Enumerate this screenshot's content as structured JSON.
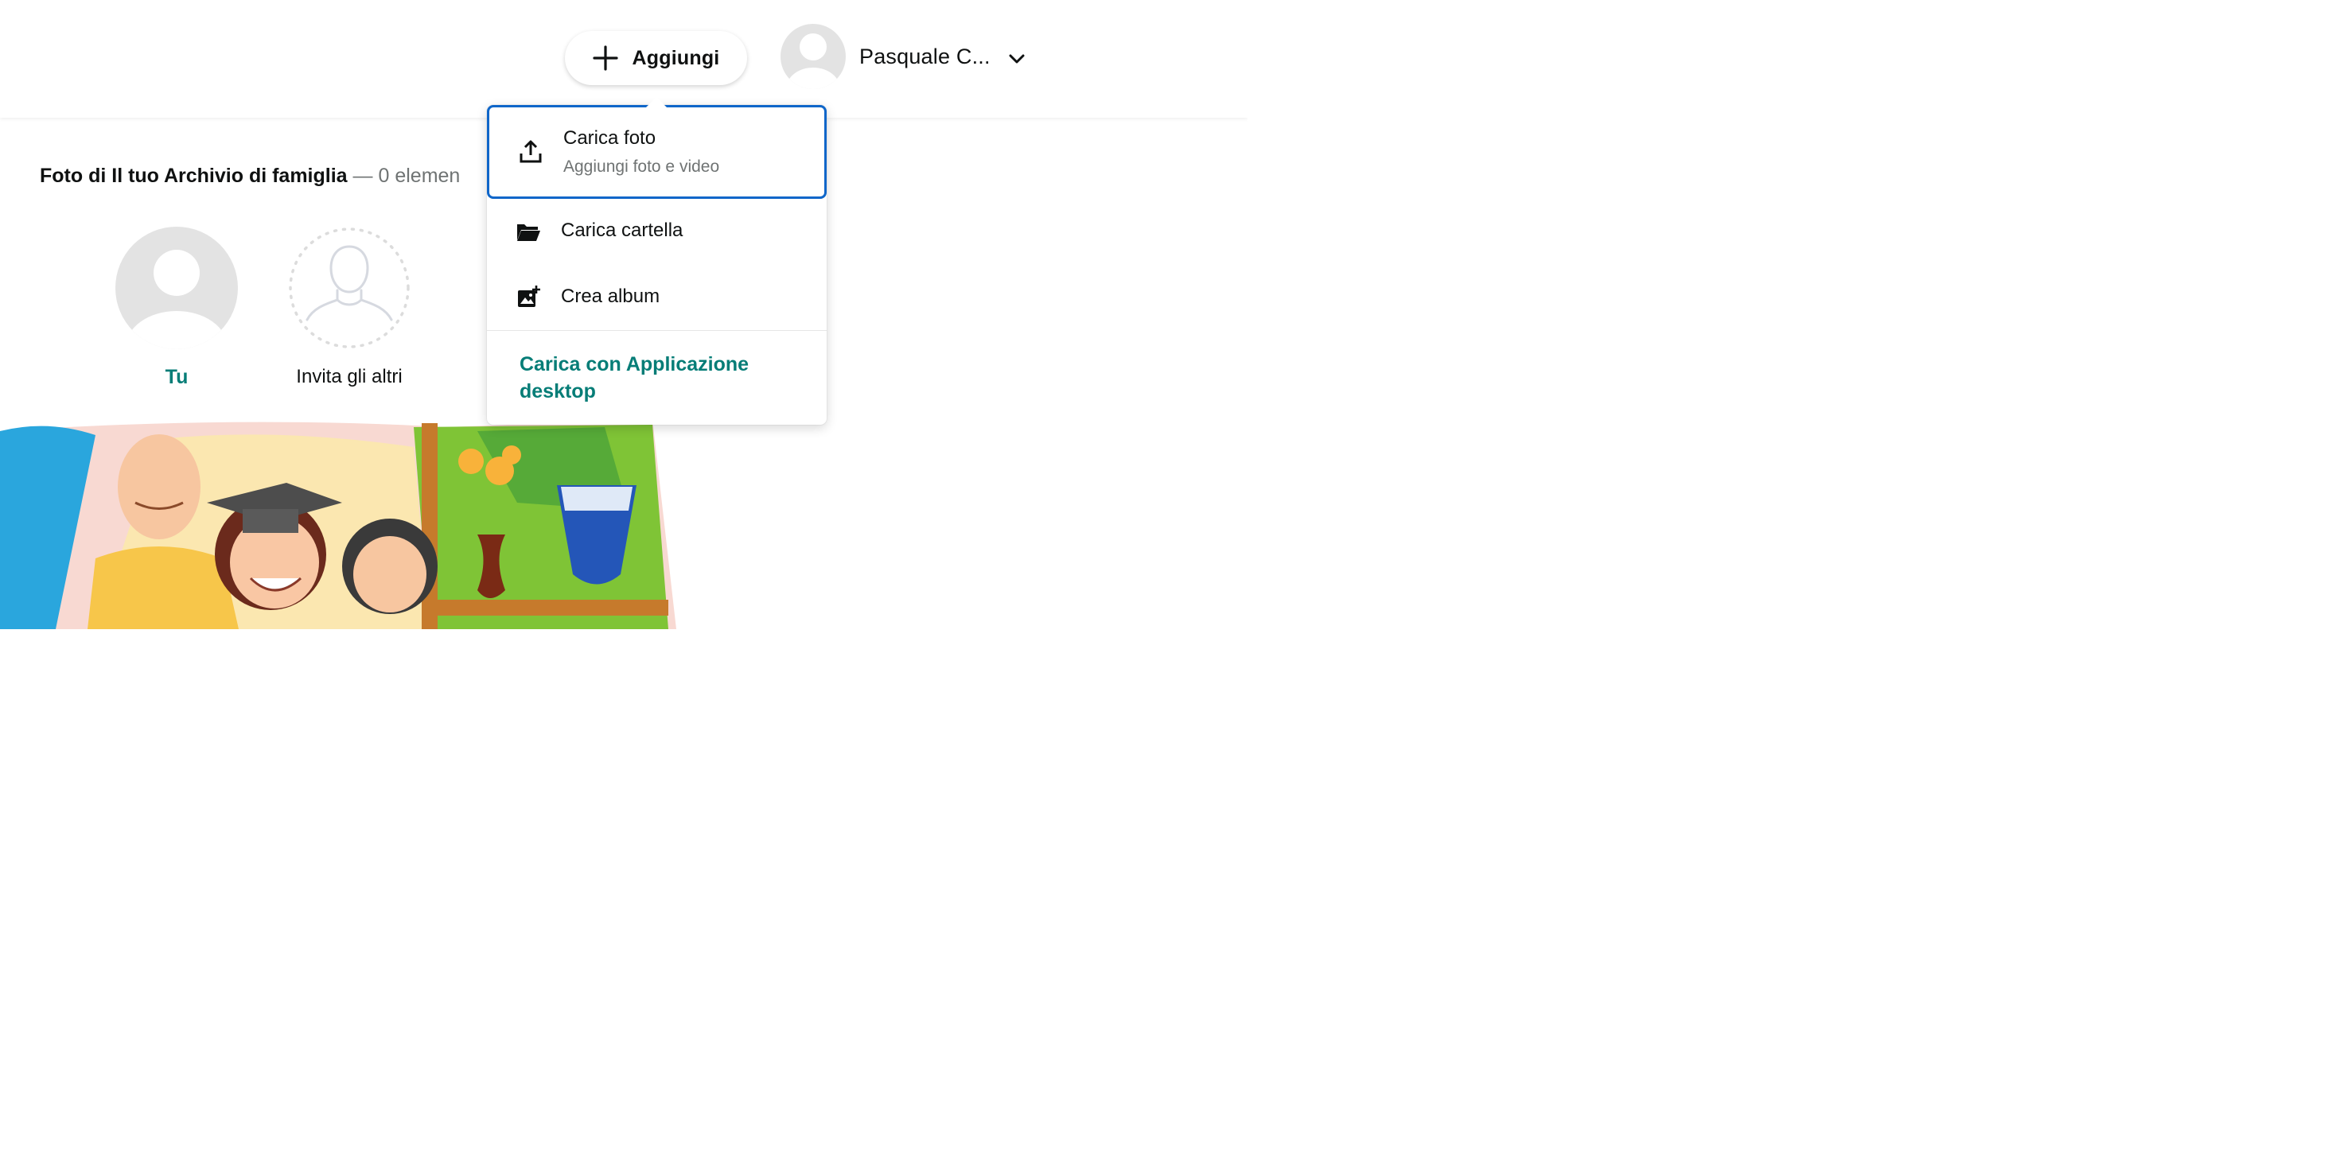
{
  "header": {
    "add_label": "Aggiungi",
    "user_name": "Pasquale C..."
  },
  "section": {
    "title": "Foto di Il tuo Archivio di famiglia",
    "count": "— 0 elemen"
  },
  "people": [
    {
      "label": "Tu"
    },
    {
      "label": "Invita gli altri"
    }
  ],
  "menu": {
    "items": [
      {
        "title": "Carica foto",
        "subtitle": "Aggiungi foto e video",
        "icon": "upload-icon"
      },
      {
        "title": "Carica cartella",
        "icon": "folder-icon"
      },
      {
        "title": "Crea album",
        "icon": "add-album-icon"
      }
    ],
    "link": "Carica con Applicazione desktop"
  },
  "colors": {
    "accent_teal": "#067d77",
    "focus_blue": "#0f66c9",
    "avatar_gray": "#e3e3e3"
  }
}
